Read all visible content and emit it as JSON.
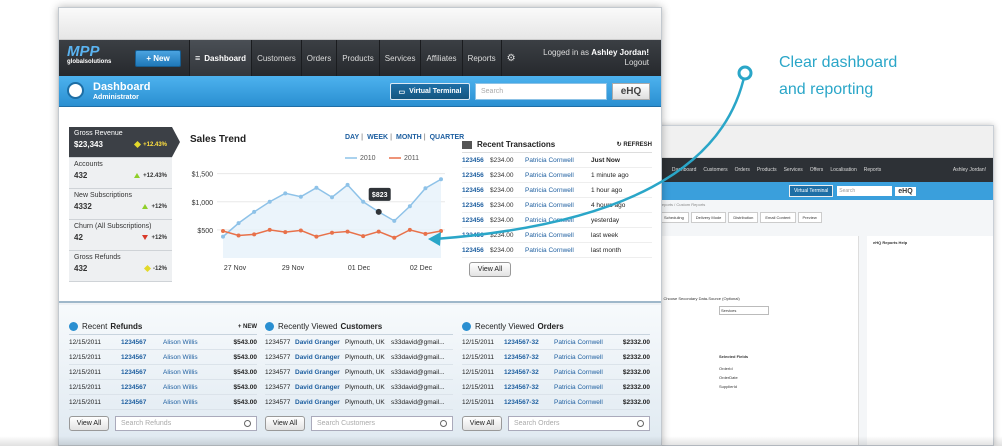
{
  "annotation": {
    "line1": "Clear dashboard",
    "line2": "and reporting"
  },
  "logo": {
    "line1": "MPP",
    "line2": "globalsolutions"
  },
  "nav": {
    "new_label": "+ New",
    "items": [
      "Dashboard",
      "Customers",
      "Orders",
      "Products",
      "Services",
      "Affiliates",
      "Reports"
    ],
    "user_line": "Logged in as",
    "user_name": "Ashley Jordan!",
    "logout": "Logout"
  },
  "header": {
    "title": "Dashboard",
    "subtitle": "Administrator",
    "virtual_terminal": "Virtual Terminal",
    "search_placeholder": "Search",
    "ehq": "eHQ"
  },
  "stats": [
    {
      "label": "Gross Revenue",
      "value": "$23,343",
      "change": "+12.43%",
      "trend": "neutral",
      "active": true
    },
    {
      "label": "Accounts",
      "value": "432",
      "change": "+12.43%",
      "trend": "up"
    },
    {
      "label": "New Subscriptions",
      "value": "4332",
      "change": "+12%",
      "trend": "up"
    },
    {
      "label": "Churn (All Subscriptions)",
      "value": "42",
      "change": "+12%",
      "trend": "down"
    },
    {
      "label": "Gross Refunds",
      "value": "432",
      "change": "-12%",
      "trend": "neutral"
    }
  ],
  "sales_trend": {
    "title": "Sales Trend",
    "ranges": [
      "DAY",
      "WEEK",
      "MONTH",
      "QUARTER"
    ],
    "tooltip": "$823"
  },
  "chart_data": {
    "type": "line",
    "title": "Sales Trend",
    "x": [
      "27 Nov",
      "29 Nov",
      "01 Dec",
      "02 Dec"
    ],
    "y_ticks": [
      "$1,500",
      "$1,000",
      "$500"
    ],
    "ylim": [
      0,
      1600
    ],
    "legend_position": "top-right",
    "series": [
      {
        "name": "2010",
        "color": "#8ec2e8",
        "values": [
          380,
          620,
          820,
          1000,
          1150,
          1090,
          1250,
          1080,
          1300,
          1000,
          820,
          660,
          920,
          1240,
          1400
        ]
      },
      {
        "name": "2011",
        "color": "#e8714a",
        "values": [
          480,
          400,
          420,
          500,
          460,
          490,
          380,
          450,
          470,
          390,
          470,
          360,
          500,
          430,
          480
        ]
      }
    ]
  },
  "transactions": {
    "title": "Recent Transactions",
    "refresh": "REFRESH",
    "rows": [
      {
        "id": "123456",
        "amount": "$234.00",
        "name": "Patricia Cornwell",
        "time": "Just Now"
      },
      {
        "id": "123456",
        "amount": "$234.00",
        "name": "Patricia Cornwell",
        "time": "1 minute ago"
      },
      {
        "id": "123456",
        "amount": "$234.00",
        "name": "Patricia Cornwell",
        "time": "1 hour ago"
      },
      {
        "id": "123456",
        "amount": "$234.00",
        "name": "Patricia Cornwell",
        "time": "4 hours ago"
      },
      {
        "id": "123456",
        "amount": "$234.00",
        "name": "Patricia Cornwell",
        "time": "yesterday"
      },
      {
        "id": "123456",
        "amount": "$234.00",
        "name": "Patricia Cornwell",
        "time": "last week"
      },
      {
        "id": "123456",
        "amount": "$234.00",
        "name": "Patricia Cornwell",
        "time": "last month"
      }
    ],
    "view_all": "View All"
  },
  "refunds": {
    "title_pre": "Recent",
    "title_bold": "Refunds",
    "new": "NEW",
    "rows": [
      {
        "date": "12/15/2011",
        "id": "1234567",
        "name": "Alison Willis",
        "amount": "$543.00"
      },
      {
        "date": "12/15/2011",
        "id": "1234567",
        "name": "Alison Willis",
        "amount": "$543.00"
      },
      {
        "date": "12/15/2011",
        "id": "1234567",
        "name": "Alison Willis",
        "amount": "$543.00"
      },
      {
        "date": "12/15/2011",
        "id": "1234567",
        "name": "Alison Willis",
        "amount": "$543.00"
      },
      {
        "date": "12/15/2011",
        "id": "1234567",
        "name": "Alison Willis",
        "amount": "$543.00"
      }
    ],
    "view_all": "View All",
    "search_placeholder": "Search Refunds"
  },
  "customers": {
    "title_pre": "Recently Viewed",
    "title_bold": "Customers",
    "rows": [
      {
        "id": "1234577",
        "name": "David Granger",
        "city": "Plymouth, UK",
        "email": "s33david@gmail..."
      },
      {
        "id": "1234577",
        "name": "David Granger",
        "city": "Plymouth, UK",
        "email": "s33david@gmail..."
      },
      {
        "id": "1234577",
        "name": "David Granger",
        "city": "Plymouth, UK",
        "email": "s33david@gmail..."
      },
      {
        "id": "1234577",
        "name": "David Granger",
        "city": "Plymouth, UK",
        "email": "s33david@gmail..."
      },
      {
        "id": "1234577",
        "name": "David Granger",
        "city": "Plymouth, UK",
        "email": "s33david@gmail..."
      }
    ],
    "view_all": "View All",
    "search_placeholder": "Search Customers"
  },
  "orders": {
    "title_pre": "Recently Viewed",
    "title_bold": "Orders",
    "rows": [
      {
        "date": "12/15/2011",
        "id": "1234567-32",
        "name": "Patricia Cornwell",
        "amount": "$2332.00"
      },
      {
        "date": "12/15/2011",
        "id": "1234567-32",
        "name": "Patricia Cornwell",
        "amount": "$2332.00"
      },
      {
        "date": "12/15/2011",
        "id": "1234567-32",
        "name": "Patricia Cornwell",
        "amount": "$2332.00"
      },
      {
        "date": "12/15/2011",
        "id": "1234567-32",
        "name": "Patricia Cornwell",
        "amount": "$2332.00"
      },
      {
        "date": "12/15/2011",
        "id": "1234567-32",
        "name": "Patricia Cornwell",
        "amount": "$2332.00"
      }
    ],
    "view_all": "View All",
    "search_placeholder": "Search Orders"
  },
  "secondary": {
    "nav_items": [
      "Dashboard",
      "Customers",
      "Orders",
      "Products",
      "Services",
      "Offers",
      "Localisation",
      "Reports"
    ],
    "user": "Ashley Jordan!",
    "crumb": "Reports  /  Custom Reports",
    "tabs": [
      "Scheduling",
      "Delivery Mode",
      "Distribution",
      "Email Content",
      "Preview"
    ],
    "help_title": "eHQ Reports Help",
    "field_label": "2. Choose Secondary Data-Source (Optional)",
    "field_value": "Services",
    "selected_fields": "Selected Fields",
    "fields": [
      "OrderId",
      "OrderDate",
      "SupplierId"
    ]
  }
}
